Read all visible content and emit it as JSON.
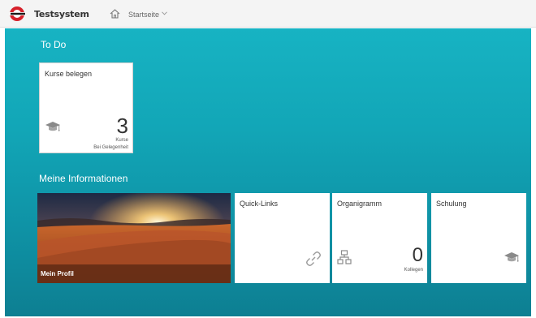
{
  "header": {
    "app_title": "Testsystem",
    "nav_label": "Startseite",
    "logo": "logo-icon",
    "home": "home-icon"
  },
  "sections": {
    "todo": "To Do",
    "info": "Meine Informationen"
  },
  "tiles": {
    "kurse": {
      "title": "Kurse belegen",
      "count": "3",
      "unit": "Kurse",
      "info": "Bei Gelegenheit",
      "icon": "graduation-cap-icon"
    },
    "profil": {
      "label": "Mein Profil"
    },
    "quicklinks": {
      "title": "Quick-Links",
      "icon": "link-icon"
    },
    "organigramm": {
      "title": "Organigramm",
      "count": "0",
      "unit": "Kollegen",
      "icon": "org-chart-icon"
    },
    "schulung": {
      "title": "Schulung",
      "icon": "graduation-cap-icon"
    }
  },
  "colors": {
    "accent": "#12a6b7",
    "logo_red": "#d6202a"
  }
}
